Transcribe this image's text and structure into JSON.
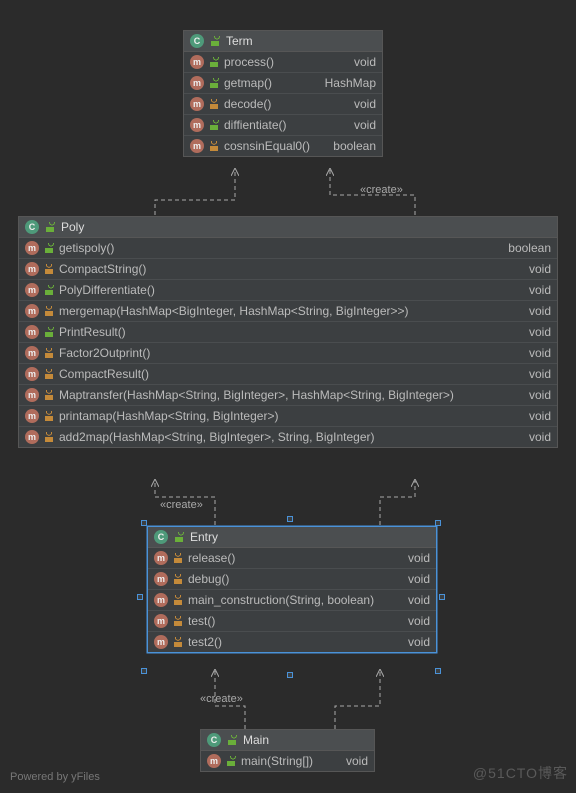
{
  "footer": {
    "powered": "Powered by yFiles",
    "watermark": "@51CTO博客"
  },
  "labels": {
    "create": "«create»"
  },
  "classes": {
    "term": {
      "name": "Term",
      "members": [
        {
          "vis": "open",
          "name": "process()",
          "type": "void"
        },
        {
          "vis": "open",
          "name": "getmap()",
          "type": "HashMap"
        },
        {
          "vis": "lock",
          "name": "decode()",
          "type": "void"
        },
        {
          "vis": "open",
          "name": "diffientiate()",
          "type": "void"
        },
        {
          "vis": "lock",
          "name": "cosnsinEqual0()",
          "type": "boolean"
        }
      ]
    },
    "poly": {
      "name": "Poly",
      "members": [
        {
          "vis": "open",
          "name": "getispoly()",
          "type": "boolean"
        },
        {
          "vis": "lock",
          "name": "CompactString()",
          "type": "void"
        },
        {
          "vis": "open",
          "name": "PolyDifferentiate()",
          "type": "void"
        },
        {
          "vis": "lock",
          "name": "mergemap(HashMap<BigInteger, HashMap<String, BigInteger>>)",
          "type": "void"
        },
        {
          "vis": "open",
          "name": "PrintResult()",
          "type": "void"
        },
        {
          "vis": "lock",
          "name": "Factor2Outprint()",
          "type": "void"
        },
        {
          "vis": "lock",
          "name": "CompactResult()",
          "type": "void"
        },
        {
          "vis": "lock",
          "name": "Maptransfer(HashMap<String, BigInteger>, HashMap<String, BigInteger>)",
          "type": "void"
        },
        {
          "vis": "lock",
          "name": "printamap(HashMap<String, BigInteger>)",
          "type": "void"
        },
        {
          "vis": "lock",
          "name": "add2map(HashMap<String, BigInteger>, String, BigInteger)",
          "type": "void"
        }
      ]
    },
    "entry": {
      "name": "Entry",
      "members": [
        {
          "vis": "lock",
          "name": "release()",
          "type": "void"
        },
        {
          "vis": "lock",
          "name": "debug()",
          "type": "void"
        },
        {
          "vis": "lock",
          "name": "main_construction(String, boolean)",
          "type": "void"
        },
        {
          "vis": "lock",
          "name": "test()",
          "type": "void"
        },
        {
          "vis": "lock",
          "name": "test2()",
          "type": "void"
        }
      ]
    },
    "main": {
      "name": "Main",
      "members": [
        {
          "vis": "open",
          "name": "main(String[])",
          "type": "void"
        }
      ]
    }
  }
}
